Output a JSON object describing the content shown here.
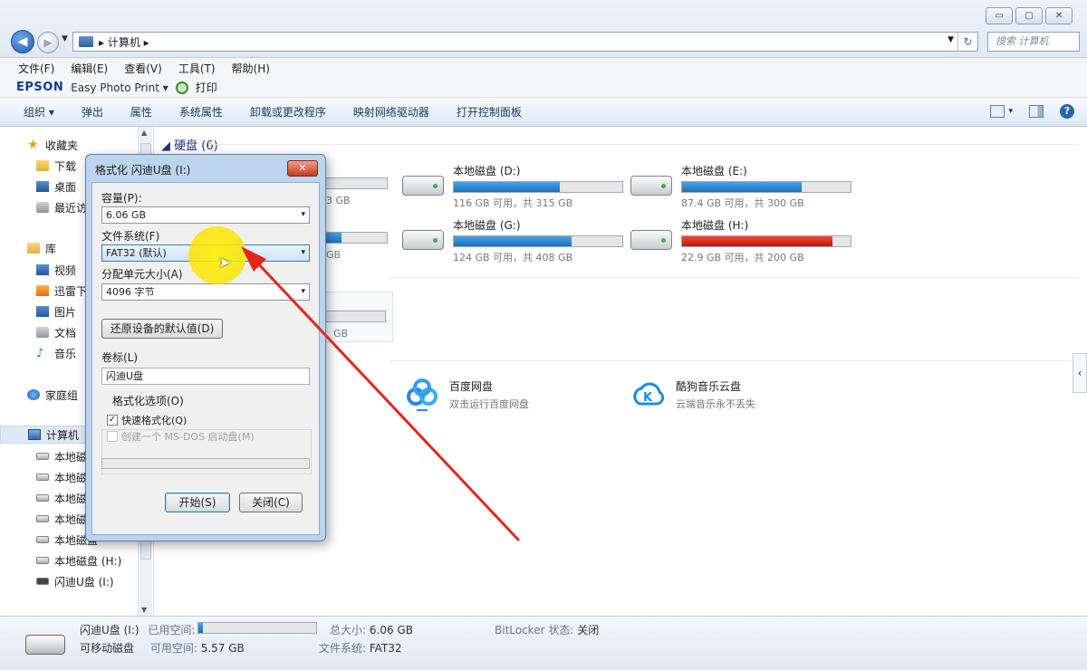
{
  "window": {
    "min_label": "▭",
    "max_label": "▢",
    "close_label": "✕",
    "address_path": "▸ 计算机 ▸",
    "search_placeholder": "搜索 计算机"
  },
  "menu": [
    "文件(F)",
    "编辑(E)",
    "查看(V)",
    "工具(T)",
    "帮助(H)"
  ],
  "epson": {
    "logo": "EPSON",
    "app": "Easy Photo Print ▾",
    "print_label": "打印"
  },
  "commands": {
    "items": [
      "组织 ▾",
      "弹出",
      "属性",
      "系统属性",
      "卸载或更改程序",
      "映射网络驱动器",
      "打开控制面板"
    ],
    "view_arrow": "▾"
  },
  "nav": {
    "favorites": "收藏夹",
    "downloads": "下载",
    "desktop": "桌面",
    "recent": "最近访问",
    "library": "库",
    "videos": "视频",
    "thunder": "迅雷下载",
    "pictures": "图片",
    "documents": "文档",
    "music": "音乐",
    "homegroup": "家庭组",
    "computer": "计算机",
    "local_c": "本地磁盘",
    "local_d": "本地磁盘",
    "local_e": "本地磁盘",
    "local_f": "本地磁盘",
    "local_g": "本地磁盘",
    "local_h": "本地磁盘 (H:)",
    "usb": "闪迪U盘 (I:)"
  },
  "content": {
    "group_title": "硬盘 (6)",
    "drives": [
      {
        "name": "本地磁盘 (D:)",
        "free": "116 GB 可用，共 315 GB",
        "used_fraction": 0.63
      },
      {
        "name": "本地磁盘 (E:)",
        "free": "87.4 GB 可用，共 300 GB",
        "used_fraction": 0.71
      },
      {
        "name": "本地磁盘 (G:)",
        "free": "124 GB 可用，共 408 GB",
        "used_fraction": 0.7
      },
      {
        "name": "本地磁盘 (H:)",
        "free": "22.9 GB 可用，共 200 GB",
        "used_fraction": 0.89
      }
    ],
    "partial_c_free": "3 GB",
    "partial_f_free": "GB",
    "partial_misc_free": "GB",
    "clouds": [
      {
        "name": "百度网盘",
        "desc": "双击运行百度网盘"
      },
      {
        "name": "酷狗音乐云盘",
        "desc": "云端音乐永不丢失"
      }
    ]
  },
  "details": {
    "name": "闪迪U盘 (I:)",
    "type": "可移动磁盘",
    "used_label": "已用空间:",
    "used_fraction": 0.04,
    "free_label": "可用空间:",
    "free_value": "5.57 GB",
    "total_label": "总大小:",
    "total_value": "6.06 GB",
    "fs_label": "文件系统:",
    "fs_value": "FAT32",
    "bitlocker_label": "BitLocker 状态:",
    "bitlocker_value": "关闭"
  },
  "dialog": {
    "title": "格式化 闪迪U盘 (I:)",
    "close_label": "✕",
    "capacity_label": "容量(P):",
    "capacity_value": "6.06 GB",
    "fs_label": "文件系统(F)",
    "fs_value": "FAT32 (默认)",
    "alloc_label": "分配单元大小(A)",
    "alloc_value": "4096 字节",
    "restore_button": "还原设备的默认值(D)",
    "volume_label": "卷标(L)",
    "volume_value": "闪迪U盘",
    "options_label": "格式化选项(O)",
    "quick_format": "快速格式化(Q)",
    "msdos_disk": "创建一个 MS-DOS 启动盘(M)",
    "start_button": "开始(S)",
    "close_button": "关闭(C)",
    "arrow": "▾",
    "check_mark": "✓"
  },
  "colors": {
    "arrow": "#e3261c",
    "highlight": "#f6df00",
    "accent": "#1d6fbd",
    "bar_red": "#c8120a"
  }
}
